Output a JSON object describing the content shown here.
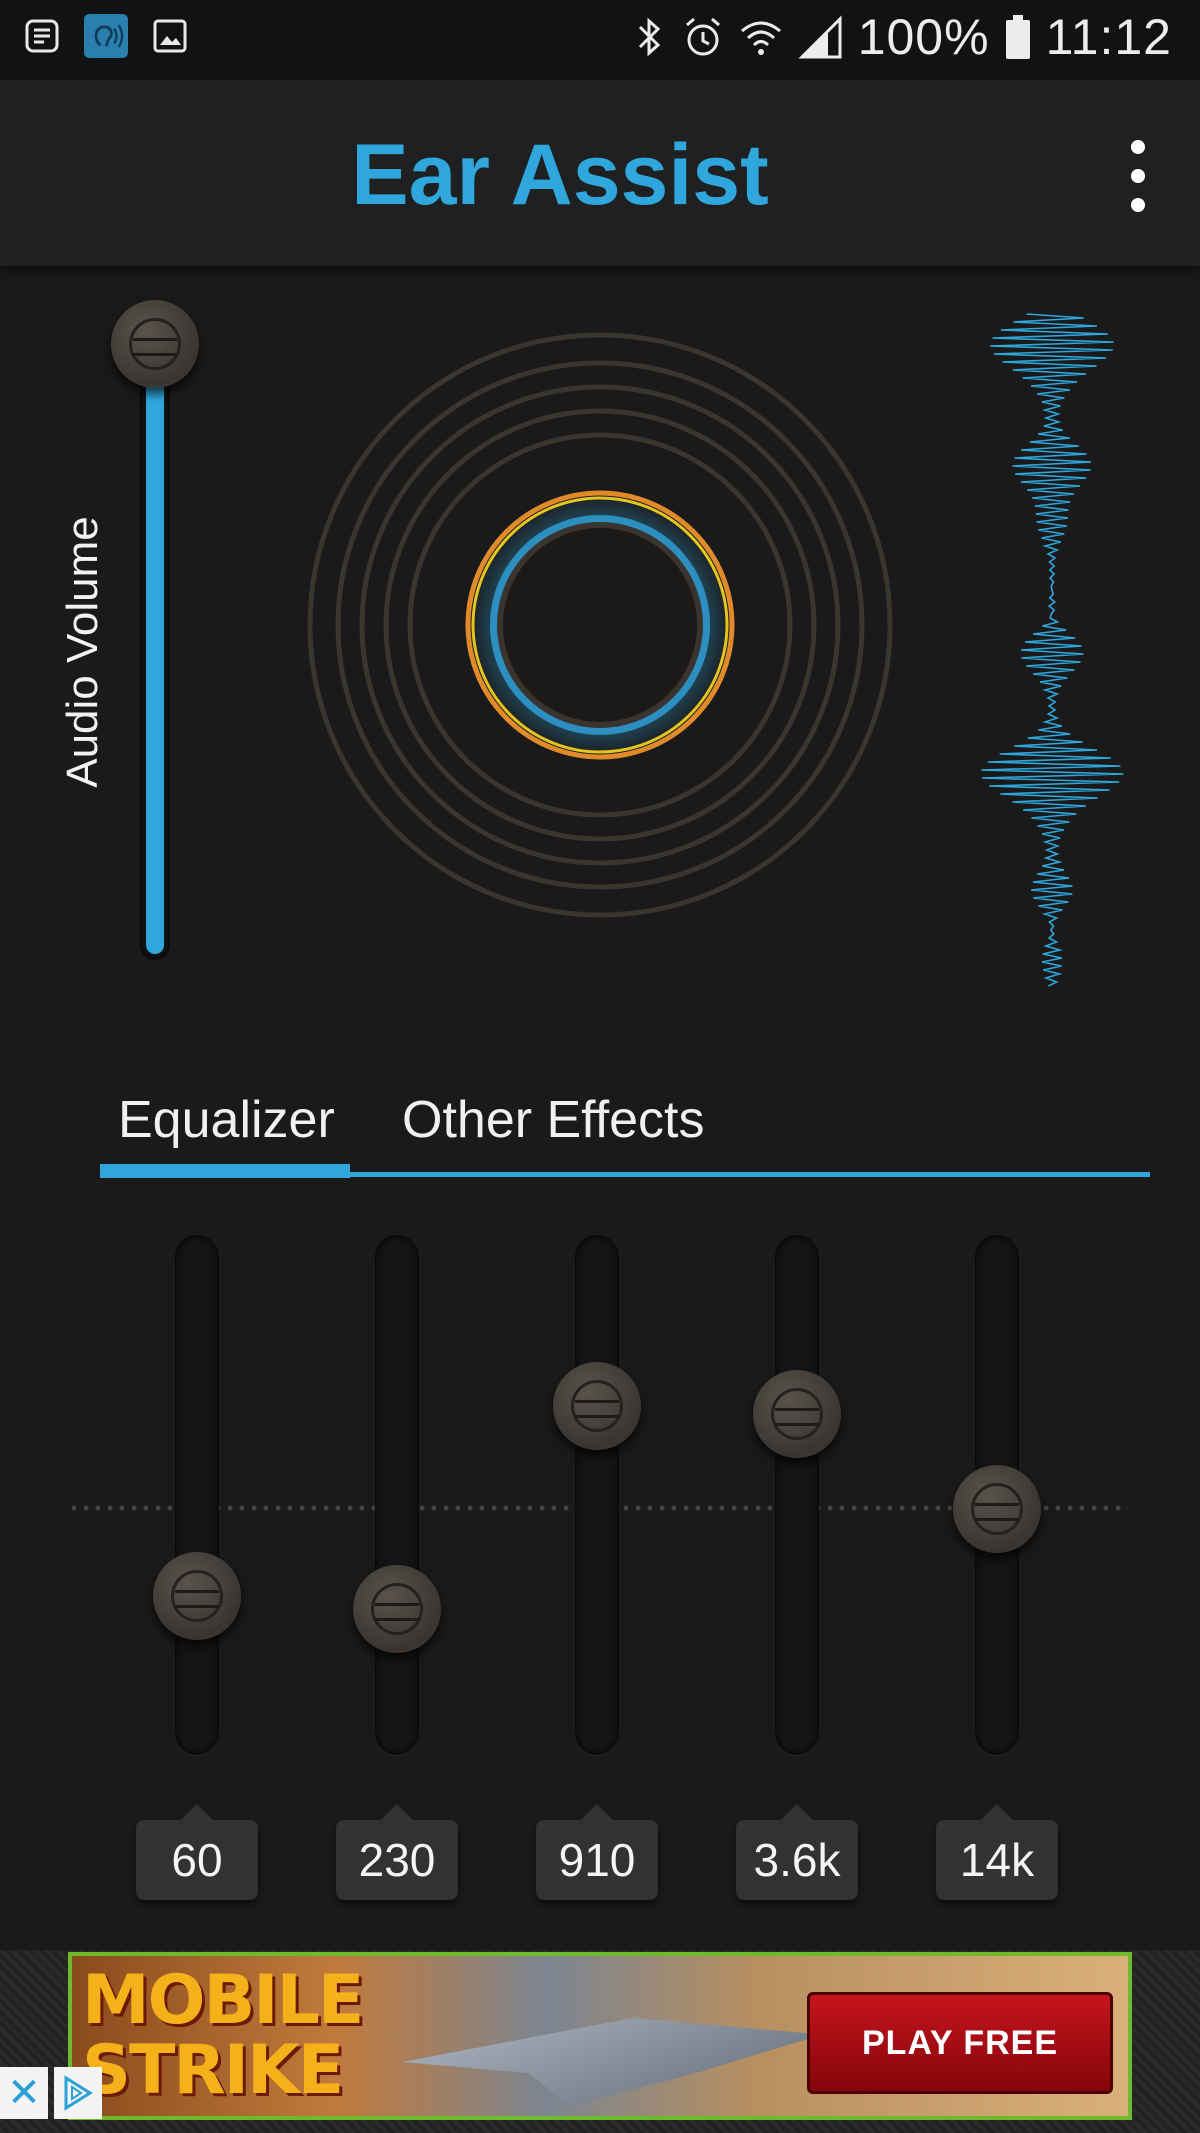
{
  "status_bar": {
    "battery_percent": "100%",
    "time": "11:12",
    "left_icons": [
      "notes-icon",
      "ear-app-icon",
      "image-icon"
    ],
    "right_icons": [
      "bluetooth-icon",
      "alarm-icon",
      "wifi-icon",
      "signal-icon",
      "battery-icon"
    ]
  },
  "app_bar": {
    "title": "Ear Assist",
    "title_color": "#2fa7dc",
    "menu_icon": "overflow-menu-icon"
  },
  "volume": {
    "label": "Audio Volume",
    "level": 1.0
  },
  "tabs": [
    {
      "label": "Equalizer",
      "selected": true
    },
    {
      "label": "Other Effects",
      "selected": false
    }
  ],
  "equalizer": {
    "bands": [
      {
        "label": "60",
        "level": 0.29
      },
      {
        "label": "230",
        "level": 0.26
      },
      {
        "label": "910",
        "level": 0.73
      },
      {
        "label": "3.6k",
        "level": 0.71
      },
      {
        "label": "14k",
        "level": 0.49
      }
    ]
  },
  "ad": {
    "title_line1": "MOBILE",
    "title_line2": "STRIKE",
    "button_label": "PLAY FREE",
    "close_glyph": "✕"
  },
  "colors": {
    "accent": "#2fa7dc",
    "background": "#1a1a1b",
    "ring_orange": "#e08a2a",
    "ring_yellow": "#f0e020"
  }
}
